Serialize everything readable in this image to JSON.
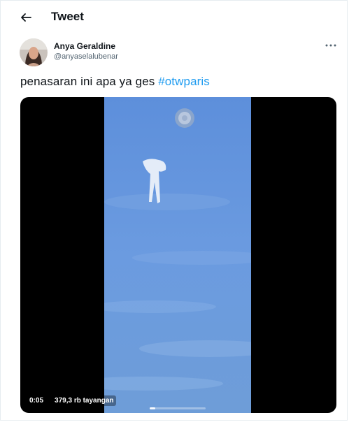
{
  "header": {
    "title": "Tweet",
    "back_icon": "arrow-left-icon"
  },
  "tweet": {
    "author_name": "Anya Geraldine",
    "author_handle": "@anyaselalubenar",
    "text": "penasaran ini apa ya ges ",
    "hashtag": "#otwparis",
    "more_icon": "more-horizontal-icon"
  },
  "video": {
    "time": "0:05",
    "views": "379,3 rb tayangan",
    "progress_fraction": 0.1
  },
  "colors": {
    "accent": "#1d9bf0",
    "text_primary": "#0f1419",
    "text_secondary": "#536471",
    "sky_blue": "#5c8fd6",
    "media_background": "#000000"
  }
}
